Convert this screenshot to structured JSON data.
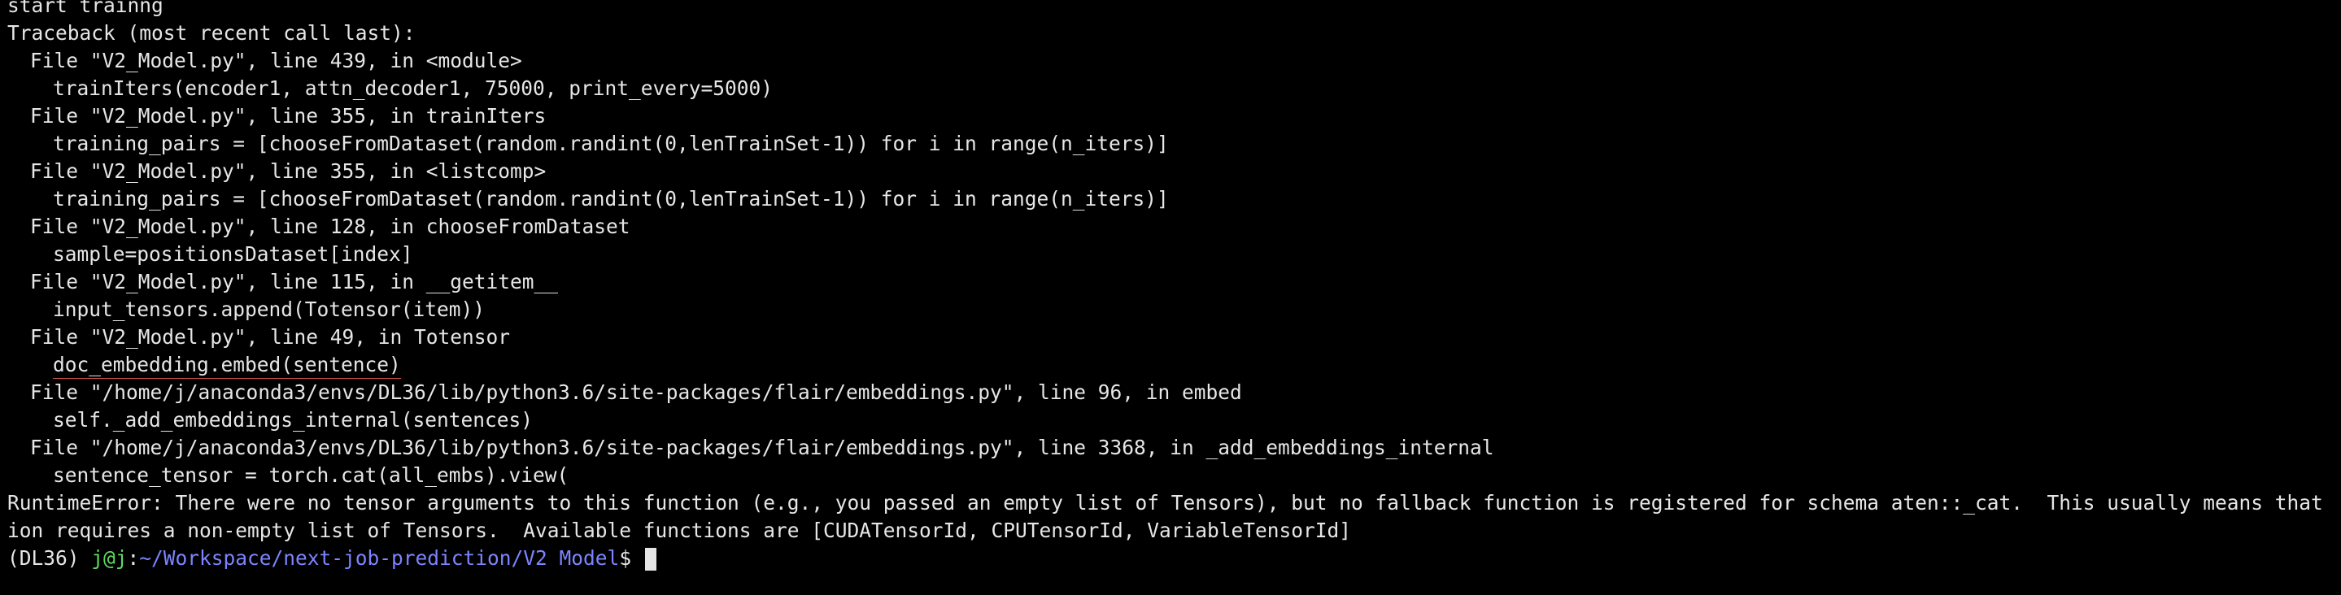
{
  "terminal": {
    "lines": [
      "start trainng",
      "Traceback (most recent call last):",
      "File \"V2_Model.py\", line 439, in <module>",
      "trainIters(encoder1, attn_decoder1, 75000, print_every=5000)",
      "File \"V2_Model.py\", line 355, in trainIters",
      "training_pairs = [chooseFromDataset(random.randint(0,lenTrainSet-1)) for i in range(n_iters)]",
      "File \"V2_Model.py\", line 355, in <listcomp>",
      "training_pairs = [chooseFromDataset(random.randint(0,lenTrainSet-1)) for i in range(n_iters)]",
      "File \"V2_Model.py\", line 128, in chooseFromDataset",
      "sample=positionsDataset[index]",
      "File \"V2_Model.py\", line 115, in __getitem__",
      "input_tensors.append(Totensor(item))",
      "File \"V2_Model.py\", line 49, in Totensor",
      "doc_embedding.embed(sentence)",
      "File \"/home/j/anaconda3/envs/DL36/lib/python3.6/site-packages/flair/embeddings.py\", line 96, in embed",
      "self._add_embeddings_internal(sentences)",
      "File \"/home/j/anaconda3/envs/DL36/lib/python3.6/site-packages/flair/embeddings.py\", line 3368, in _add_embeddings_internal",
      "sentence_tensor = torch.cat(all_embs).view(",
      "RuntimeError: There were no tensor arguments to this function (e.g., you passed an empty list of Tensors), but no fallback function is registered for schema aten::_cat.  This usually means that this funct",
      "ion requires a non-empty list of Tensors.  Available functions are [CUDATensorId, CPUTensorId, VariableTensorId]"
    ],
    "prompt": {
      "env": "(DL36) ",
      "user": "j@j",
      "separator": ":",
      "path": "~/Workspace/next-job-prediction/V2 Model",
      "sign": "$ "
    }
  },
  "colors": {
    "background": "#000000",
    "text": "#e6e6e6",
    "prompt_user": "#5fd75f",
    "prompt_path": "#7c84ff",
    "underline": "#d9534f"
  }
}
